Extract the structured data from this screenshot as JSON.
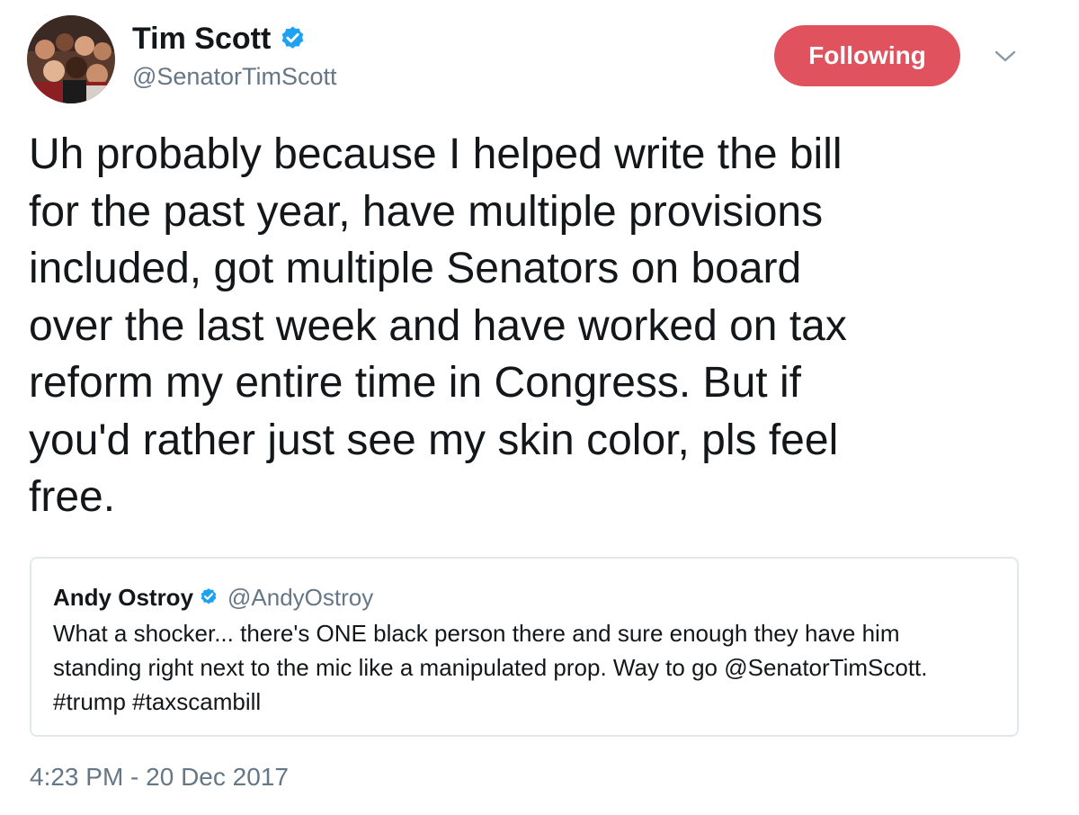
{
  "author": {
    "display_name": "Tim Scott",
    "handle": "@SenatorTimScott",
    "verified": true,
    "avatar_icon": "group-photo-avatar"
  },
  "follow_button": {
    "label": "Following",
    "color": "#e0535e"
  },
  "menu": {
    "icon": "chevron-down-icon"
  },
  "tweet": {
    "lines": [
      "Uh probably because I helped write the bill",
      "for the past year, have multiple provisions",
      "included, got multiple Senators on board",
      "over the last week and have worked on tax",
      "reform my entire time in Congress. But if",
      "you'd rather just see my skin color, pls feel",
      "free."
    ],
    "timestamp": "4:23 PM - 20 Dec 2017"
  },
  "quoted_tweet": {
    "display_name": "Andy Ostroy",
    "handle": "@AndyOstroy",
    "verified": true,
    "lines": [
      "What a shocker... there's ONE black person there and sure enough they have him",
      "standing right next to the mic like a manipulated prop. Way to go @SenatorTimScott.",
      "#trump #taxscambill"
    ]
  },
  "colors": {
    "verified_blue": "#1da1f2",
    "secondary_text": "#657786",
    "card_border": "#e1e8ed"
  }
}
